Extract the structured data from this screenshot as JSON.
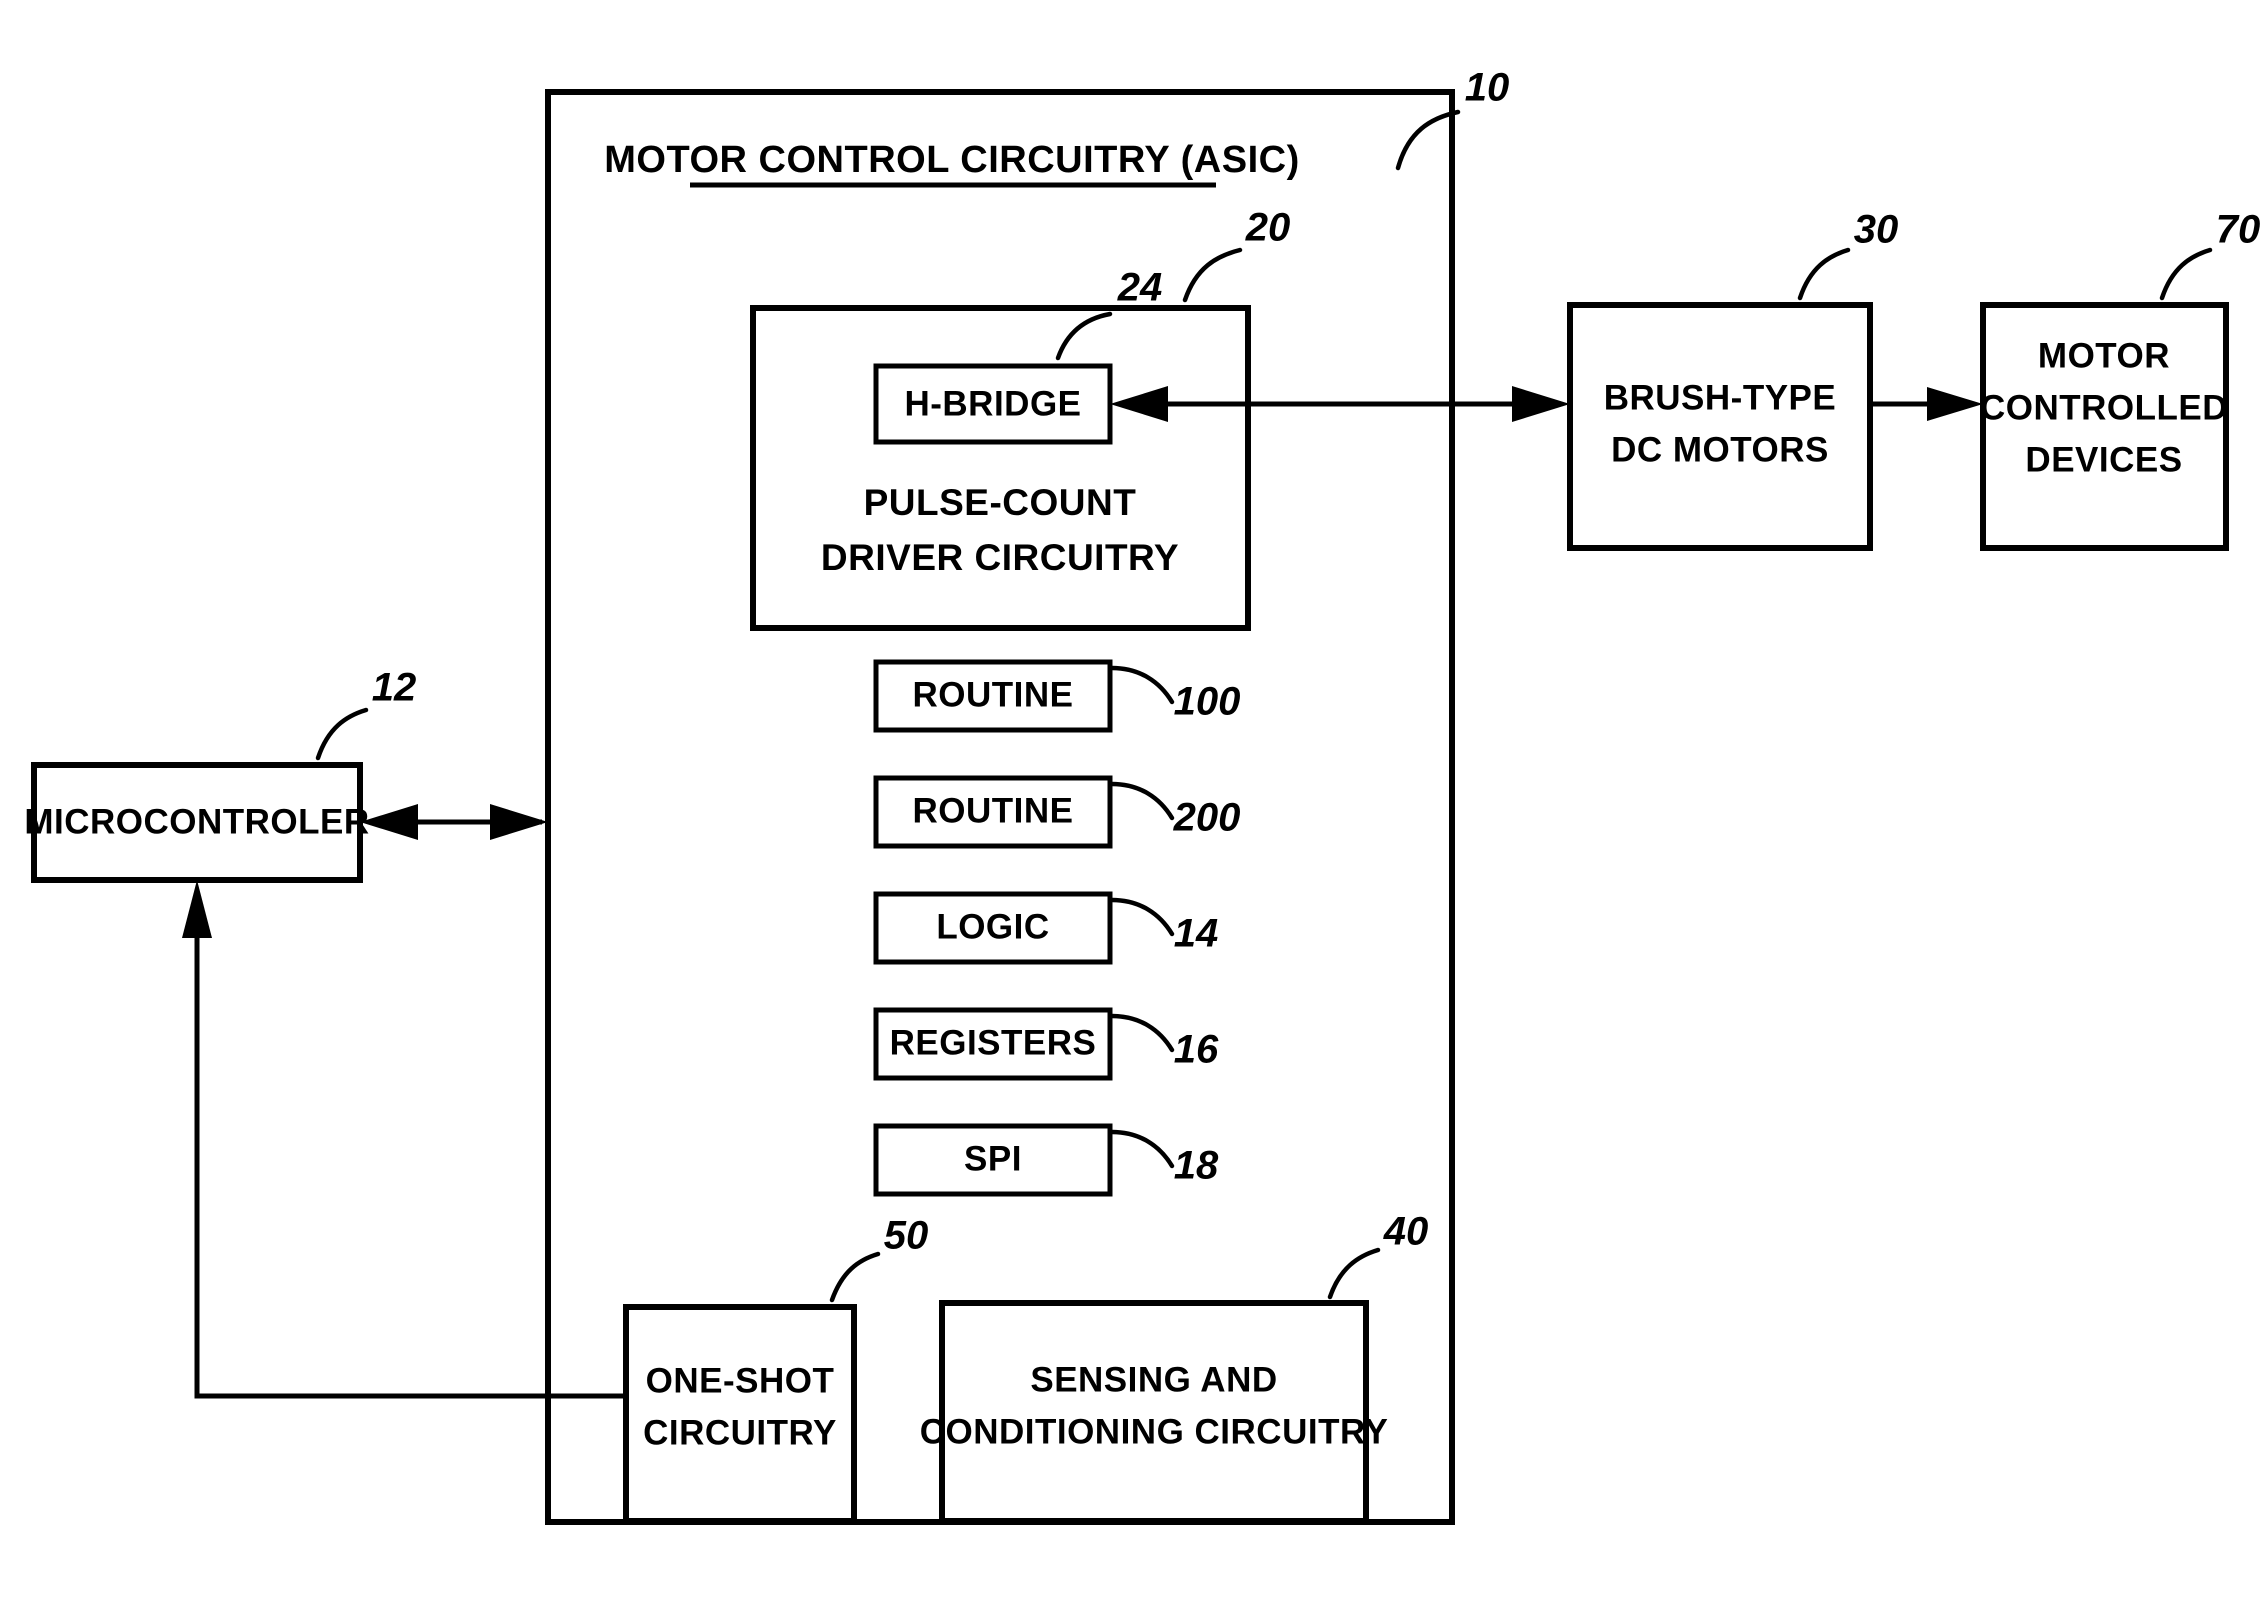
{
  "figure": {
    "type": "patent-block-diagram",
    "background_color": "#ffffff",
    "line_color": "#000000"
  },
  "asic": {
    "title": "MOTOR CONTROL CIRCUITRY (ASIC)",
    "ref": "10",
    "title_underlined": true
  },
  "blocks": {
    "driver": {
      "label_line1": "PULSE-COUNT",
      "label_line2": "DRIVER CIRCUITRY",
      "ref": "20"
    },
    "hbridge": {
      "label": "H-BRIDGE",
      "ref": "24"
    },
    "routine_100": {
      "label": "ROUTINE",
      "ref": "100"
    },
    "routine_200": {
      "label": "ROUTINE",
      "ref": "200"
    },
    "logic": {
      "label": "LOGIC",
      "ref": "14"
    },
    "registers": {
      "label": "REGISTERS",
      "ref": "16"
    },
    "spi": {
      "label": "SPI",
      "ref": "18"
    },
    "one_shot": {
      "label_line1": "ONE-SHOT",
      "label_line2": "CIRCUITRY",
      "ref": "50"
    },
    "sensing": {
      "label_line1": "SENSING AND",
      "label_line2": "CONDITIONING CIRCUITRY",
      "ref": "40"
    },
    "microcontroller": {
      "label": "MICROCONTROLER",
      "ref": "12"
    },
    "motors": {
      "label_line1": "BRUSH-TYPE",
      "label_line2": "DC MOTORS",
      "ref": "30"
    },
    "devices": {
      "label_line1": "MOTOR",
      "label_line2": "CONTROLLED",
      "label_line3": "DEVICES",
      "ref": "70"
    }
  },
  "connections": [
    {
      "name": "microcontroller-to-asic",
      "from": "microcontroller",
      "to": "asic-boundary",
      "arrow": "bidirectional"
    },
    {
      "name": "hbridge-to-motors",
      "from": "hbridge",
      "to": "motors",
      "arrow": "bidirectional"
    },
    {
      "name": "motors-to-devices",
      "from": "motors",
      "to": "devices",
      "arrow": "single"
    },
    {
      "name": "one-shot-to-microcontroller",
      "from": "one_shot",
      "to": "microcontroller",
      "arrow": "single"
    }
  ]
}
